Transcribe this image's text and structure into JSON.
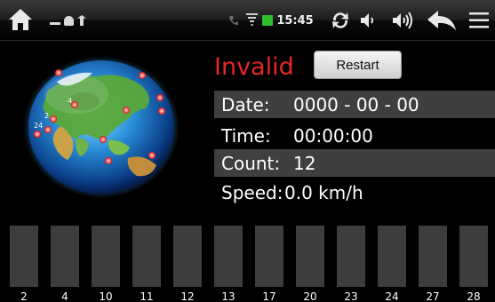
{
  "statusbar": {
    "time": "15:45",
    "icons": [
      "home-icon",
      "usb-debug-icon",
      "android-icon",
      "usb-icon",
      "phone-icon",
      "wifi-icon",
      "battery-icon",
      "refresh-icon",
      "volume-down-icon",
      "volume-up-icon",
      "back-icon",
      "menu-icon"
    ]
  },
  "gps": {
    "fix_status": "Invalid",
    "fix_status_color": "#e82525",
    "restart_label": "Restart",
    "date_label": "Date:",
    "date_value": "0000 - 00 - 00",
    "time_label": "Time:",
    "time_value": "00:00:00",
    "count_label": "Count:",
    "count_value": "12",
    "speed_label": "Speed:",
    "speed_value": "0.0 km/h"
  },
  "globe": {
    "labels": [
      "4",
      "2",
      "24"
    ]
  },
  "satellites": [
    {
      "id": "2"
    },
    {
      "id": "4"
    },
    {
      "id": "10"
    },
    {
      "id": "11"
    },
    {
      "id": "12"
    },
    {
      "id": "13"
    },
    {
      "id": "17"
    },
    {
      "id": "20"
    },
    {
      "id": "23"
    },
    {
      "id": "24"
    },
    {
      "id": "27"
    },
    {
      "id": "28"
    }
  ]
}
